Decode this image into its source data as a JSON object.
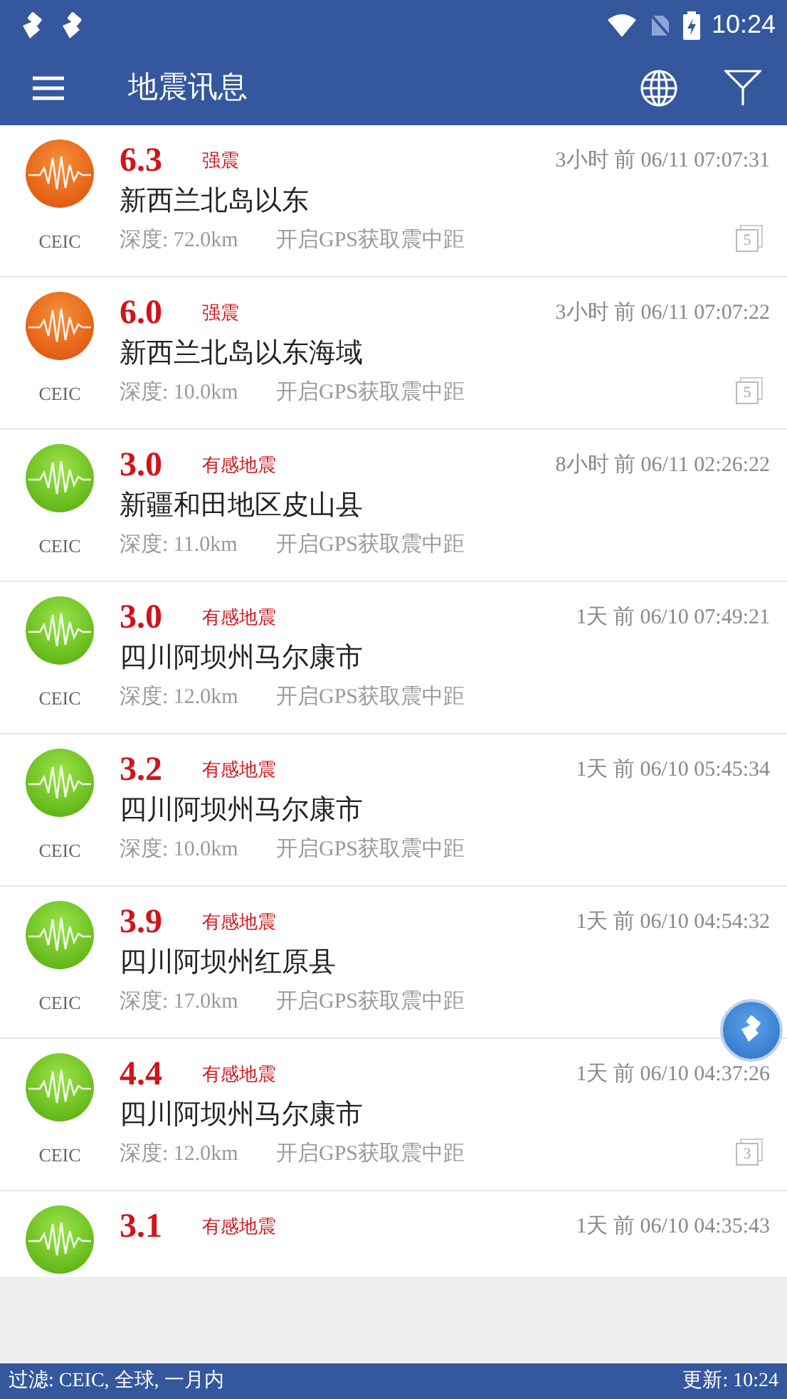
{
  "status_bar": {
    "time": "10:24"
  },
  "app_bar": {
    "title": "地震讯息"
  },
  "events": [
    {
      "kind": "strong",
      "source": "CEIC",
      "magnitude": "6.3",
      "level_label": "强震",
      "time": "3小时 前 06/11 07:07:31",
      "place": "新西兰北岛以东",
      "depth": "深度: 72.0km",
      "gps": "开启GPS获取震中距",
      "count": "5"
    },
    {
      "kind": "strong",
      "source": "CEIC",
      "magnitude": "6.0",
      "level_label": "强震",
      "time": "3小时 前 06/11 07:07:22",
      "place": "新西兰北岛以东海域",
      "depth": "深度: 10.0km",
      "gps": "开启GPS获取震中距",
      "count": "5"
    },
    {
      "kind": "felt",
      "source": "CEIC",
      "magnitude": "3.0",
      "level_label": "有感地震",
      "time": "8小时 前 06/11 02:26:22",
      "place": "新疆和田地区皮山县",
      "depth": "深度: 11.0km",
      "gps": "开启GPS获取震中距"
    },
    {
      "kind": "felt",
      "source": "CEIC",
      "magnitude": "3.0",
      "level_label": "有感地震",
      "time": "1天 前 06/10 07:49:21",
      "place": "四川阿坝州马尔康市",
      "depth": "深度: 12.0km",
      "gps": "开启GPS获取震中距"
    },
    {
      "kind": "felt",
      "source": "CEIC",
      "magnitude": "3.2",
      "level_label": "有感地震",
      "time": "1天 前 06/10 05:45:34",
      "place": "四川阿坝州马尔康市",
      "depth": "深度: 10.0km",
      "gps": "开启GPS获取震中距"
    },
    {
      "kind": "felt",
      "source": "CEIC",
      "magnitude": "3.9",
      "level_label": "有感地震",
      "time": "1天 前 06/10 04:54:32",
      "place": "四川阿坝州红原县",
      "depth": "深度: 17.0km",
      "gps": "开启GPS获取震中距"
    },
    {
      "kind": "felt",
      "source": "CEIC",
      "magnitude": "4.4",
      "level_label": "有感地震",
      "time": "1天 前 06/10 04:37:26",
      "place": "四川阿坝州马尔康市",
      "depth": "深度: 12.0km",
      "gps": "开启GPS获取震中距",
      "count": "3"
    },
    {
      "kind": "felt",
      "magnitude": "3.1",
      "level_label": "有感地震",
      "time": "1天 前 06/10 04:35:43"
    }
  ],
  "footer": {
    "filter": "过滤: CEIC, 全球, 一月内",
    "updated": "更新: 10:24"
  }
}
